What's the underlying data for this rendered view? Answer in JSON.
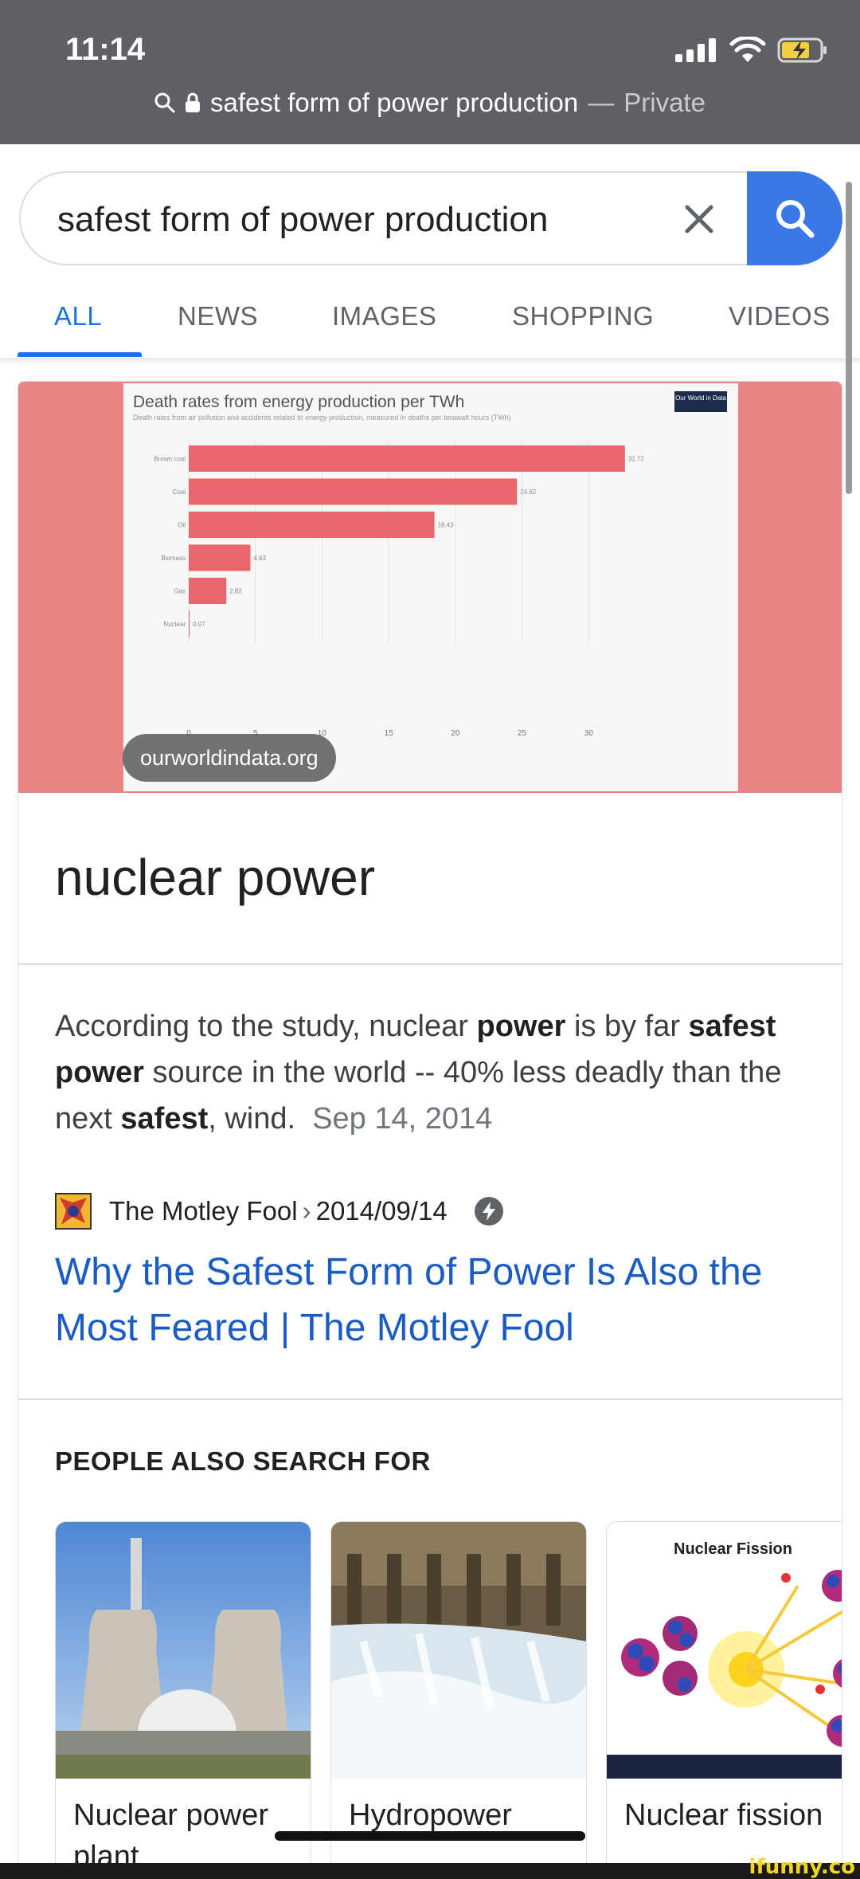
{
  "status_bar": {
    "time": "11:14"
  },
  "url_bar": {
    "query": "safest form of power production",
    "separator": "—",
    "mode": "Private"
  },
  "search": {
    "value": "safest form of power production"
  },
  "tabs": [
    {
      "label": "ALL",
      "active": true
    },
    {
      "label": "NEWS"
    },
    {
      "label": "IMAGES"
    },
    {
      "label": "SHOPPING"
    },
    {
      "label": "VIDEOS"
    }
  ],
  "featured": {
    "chart": {
      "title": "Death rates from energy production per TWh",
      "subtitle": "Death rates from air pollution and accidents related to energy production, measured in deaths per terawatt hours (TWh)",
      "logo": "Our World in Data"
    },
    "image_source": "ourworldindata.org",
    "answer": "nuclear power",
    "snippet": {
      "parts": [
        {
          "text": "According to the study, nuclear ",
          "bold": false
        },
        {
          "text": "power",
          "bold": true
        },
        {
          "text": " is by far ",
          "bold": false
        },
        {
          "text": "safest power",
          "bold": true
        },
        {
          "text": " source in the world -- 40% less deadly than the next ",
          "bold": false
        },
        {
          "text": "safest",
          "bold": true
        },
        {
          "text": ", wind.",
          "bold": false
        }
      ],
      "date": "Sep 14, 2014"
    },
    "source": {
      "site": "The Motley Fool",
      "path": "2014/09/14"
    },
    "link_title": "Why the Safest Form of Power Is Also the Most Feared | The Motley Fool"
  },
  "people_also_search": {
    "header": "PEOPLE ALSO SEARCH FOR",
    "items": [
      {
        "label": "Nuclear power plant"
      },
      {
        "label": "Hydropower"
      },
      {
        "label": "Nuclear fission"
      }
    ],
    "fission_image_title": "Nuclear Fission"
  },
  "watermark": "ifunny.co",
  "colors": {
    "accent": "#1a73e8",
    "link": "#1a5bc4",
    "hero_bg": "#e98585",
    "bar": "#e8676d"
  },
  "chart_data": {
    "type": "bar",
    "title": "Death rates from energy production per TWh",
    "categories": [
      "Brown coal",
      "Coal",
      "Oil",
      "Biomass",
      "Gas",
      "Nuclear"
    ],
    "values": [
      32.72,
      24.62,
      18.43,
      4.63,
      2.82,
      0.07
    ],
    "xlim": [
      0,
      35
    ],
    "xticks": [
      0,
      5,
      10,
      15,
      20,
      25,
      30
    ]
  }
}
